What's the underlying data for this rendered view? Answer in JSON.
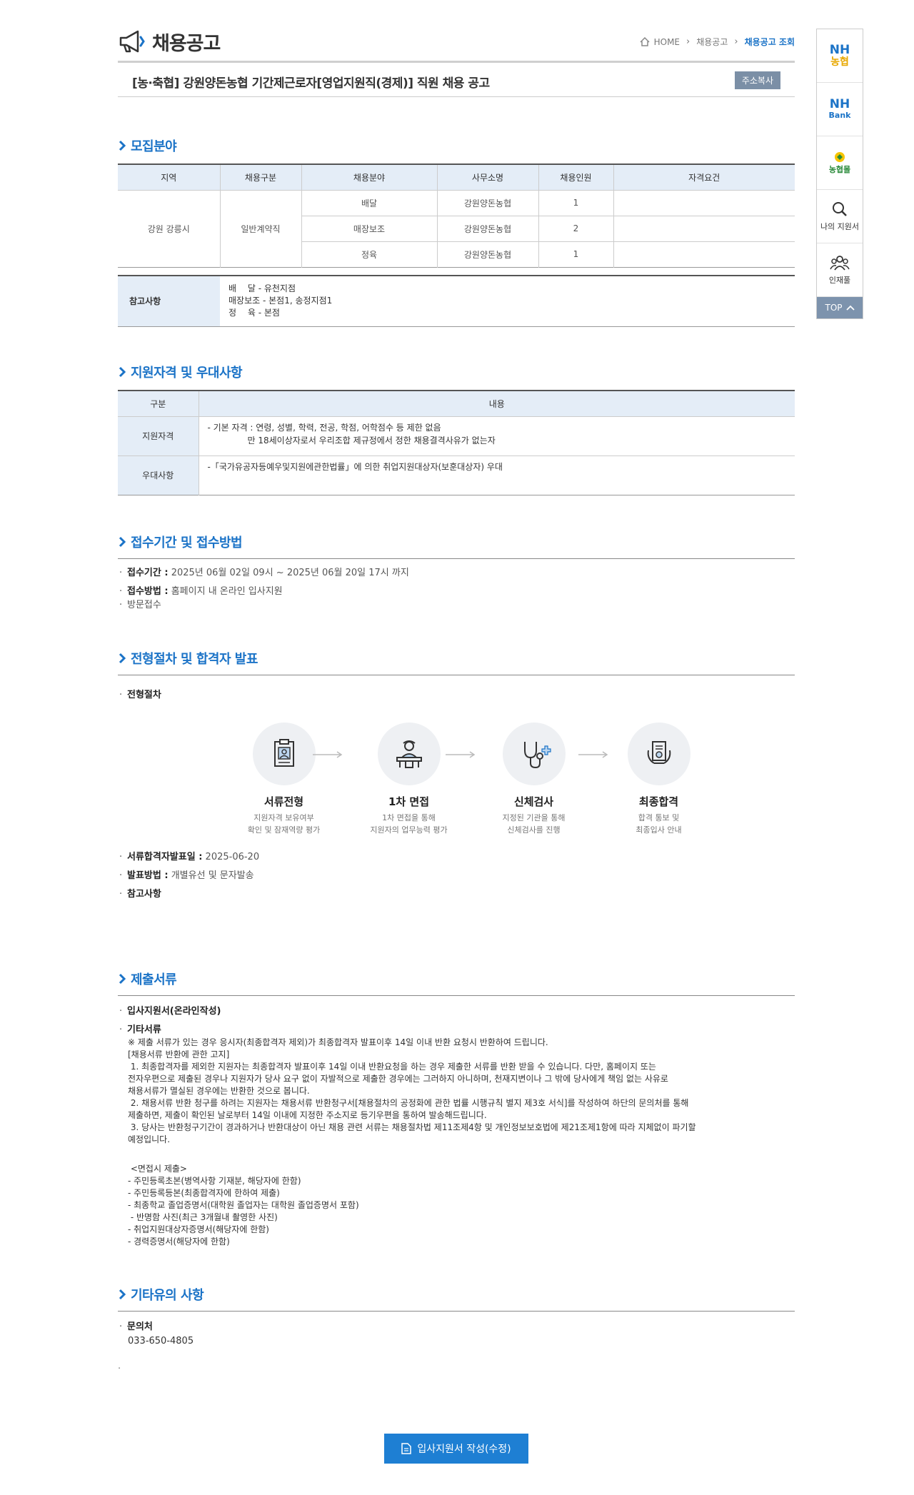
{
  "header": {
    "title": "채용공고",
    "breadcrumb": [
      "HOME",
      "채용공고",
      "채용공고 조회"
    ]
  },
  "job": {
    "title": "[농·축협] 강원양돈농협 기간제근로자[영업지원직(경제)] 직원 채용 공고",
    "copy_label": "주소복사"
  },
  "sections": {
    "recruit": "모집분야",
    "qualification": "지원자격 및 우대사항",
    "reception": "접수기간 및 접수방법",
    "process": "전형절차 및 합격자 발표",
    "documents": "제출서류",
    "other": "기타유의 사항"
  },
  "recruit_table": {
    "headers": [
      "지역",
      "채용구분",
      "채용분야",
      "사무소명",
      "채용인원",
      "자격요건"
    ],
    "region": "강원 강릉시",
    "type": "일반계약직",
    "rows": [
      {
        "field": "배달",
        "office": "강원양돈농협",
        "count": "1"
      },
      {
        "field": "매장보조",
        "office": "강원양돈농협",
        "count": "2"
      },
      {
        "field": "정육",
        "office": "강원양돈농협",
        "count": "1"
      }
    ]
  },
  "reference": {
    "label": "참고사항",
    "lines": [
      "배　 달 - 유천지점",
      "매장보조 - 본점1, 송정지점1",
      "정　 육 - 본점"
    ]
  },
  "qualification_table": {
    "headers": [
      "구분",
      "내용"
    ],
    "rows": [
      {
        "label": "지원자격",
        "line1": "- 기본 자격 : 연령, 성별, 학력, 전공, 학점, 어학점수 등 제한 없음",
        "line2": "만 18세이상자로서 우리조합 제규정에서 정한 채용결격사유가 없는자"
      },
      {
        "label": "우대사항",
        "line1": "-「국가유공자등예우및지원에관한법률」에 의한 취업지원대상자(보훈대상자) 우대",
        "line2": ""
      }
    ]
  },
  "reception": {
    "period_label": "접수기간 :",
    "period": "2025년 06월 02일 09시 ~ 2025년 06월 20일 17시 까지",
    "method_label": "접수방법 :",
    "method": "홈페이지 내 온라인 입사지원",
    "method2": "방문접수"
  },
  "process": {
    "label": "전형절차",
    "steps": [
      {
        "name": "서류전형",
        "desc1": "지원자격 보유여부",
        "desc2": "확인 및 잠재역량 평가"
      },
      {
        "name": "1차 면접",
        "desc1": "1차 면접을 통해",
        "desc2": "지원자의 업무능력 평가"
      },
      {
        "name": "신체검사",
        "desc1": "지정된 기관을 통해",
        "desc2": "신체검사를 진행"
      },
      {
        "name": "최종합격",
        "desc1": "합격 통보 및",
        "desc2": "최종입사 안내"
      }
    ],
    "announce_label": "서류합격자발표일 :",
    "announce": "2025-06-20",
    "notify_label": "발표방법 :",
    "notify": "개별유선 및 문자발송",
    "note_label": "참고사항"
  },
  "documents": {
    "online": "입사지원서(온라인작성)",
    "other_label": "기타서류",
    "text": "※ 제출 서류가 있는 경우 응시자(최종합격자 제외)가 최종합격자 발표이후 14일 이내 반환 요청시 반환하여 드립니다.\n[채용서류 반환에 관한 고지]\n 1. 최종합격자를 제외한 지원자는 최종합격자 발표이후 14일 이내 반환요청을 하는 경우 제출한 서류를 반환 받을 수 있습니다. 다만, 홈페이지 또는\n전자우편으로 제출된 경우나 지원자가 당사 요구 없이 자발적으로 제출한 경우에는 그러하지 아니하며, 천재지변이나 그 밖에 당사에게 책임 없는 사유로\n채용서류가 멸실된 경우에는 반환한 것으로 봅니다.\n 2. 채용서류 반환 청구를 하려는 지원자는 채용서류 반환청구서[채용절차의 공정화에 관한 법률 시행규칙 별지 제3호 서식]를 작성하여 하단의 문의처를 통해\n제출하면, 제출이 확인된 날로부터 14일 이내에 지정한 주소지로 등기우편을 통하여 발송해드립니다.\n 3. 당사는 반환청구기간이 경과하거나 반환대상이 아닌 채용 관련 서류는 채용절차법 제11조제4항 및 개인정보보호법에 제21조제1항에 따라 지체없이 파기할\n예정입니다.",
    "interview_text": " <면접시 제출>\n- 주민등록초본(병역사항 기재분, 해당자에 한함)\n- 주민등록등본(최종합격자에 한하여 제출)\n- 최종학교 졸업증명서(대학원 졸업자는 대학원 졸업증명서 포함)\n - 반명함 사진(최근 3개월내 촬영한 사진)\n- 취업지원대상자증명서(해당자에 한함)\n- 경력증명서(해당자에 한함)"
  },
  "other": {
    "contact_label": "문의처",
    "contact": "033-650-4805",
    "dot": "."
  },
  "apply_label": "입사지원서 작성(수정)",
  "quick": {
    "nh1_a": "NH",
    "nh1_b": "농협",
    "nh2_a": "NH",
    "nh2_b": "Bank",
    "mall": "농협몰",
    "my": "나의 지원서",
    "pool": "인재풀",
    "top": "TOP"
  },
  "colors": {
    "accent": "#1b73c7",
    "header_bg": "#e4edf7",
    "button": "#1e7fd3",
    "quick_top": "#7d93ad"
  }
}
